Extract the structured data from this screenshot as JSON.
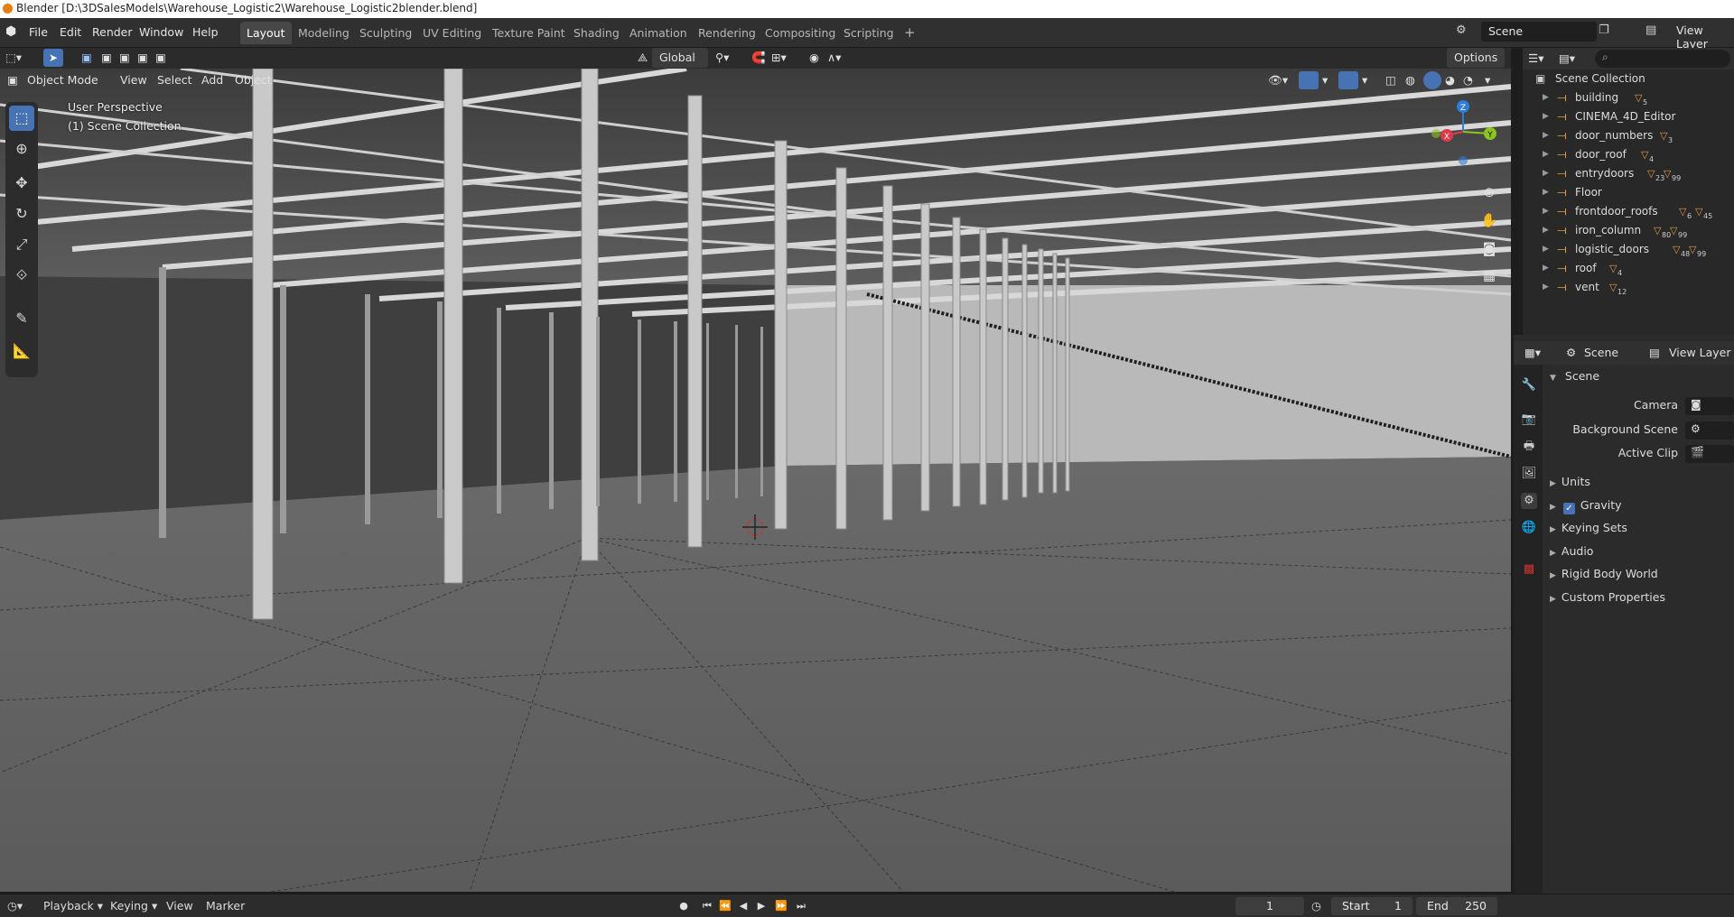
{
  "window_title": "Blender [D:\\3DSalesModels\\Warehouse_Logistic2\\Warehouse_Logistic2blender.blend]",
  "menu": [
    "File",
    "Edit",
    "Render",
    "Window",
    "Help"
  ],
  "workspaces": [
    "Layout",
    "Modeling",
    "Sculpting",
    "UV Editing",
    "Texture Paint",
    "Shading",
    "Animation",
    "Rendering",
    "Compositing",
    "Scripting"
  ],
  "add_workspace": "+",
  "scene_field": "Scene",
  "view_layer_label": "View Layer",
  "viewport_header": {
    "mode": "Object Mode",
    "menus": [
      "View",
      "Select",
      "Add",
      "Object"
    ],
    "orientation": "Global",
    "options": "Options"
  },
  "viewport_overlay": {
    "perspective": "User Perspective",
    "collection": "(1) Scene Collection"
  },
  "gizmo": {
    "z": "Z",
    "y": "Y",
    "x": "X"
  },
  "outliner": {
    "root": "Scene Collection",
    "items": [
      {
        "label": "building",
        "badges": [
          "5"
        ]
      },
      {
        "label": "CINEMA_4D_Editor",
        "badges": []
      },
      {
        "label": "door_numbers",
        "badges": [
          "3"
        ]
      },
      {
        "label": "door_roof",
        "badges": [
          "4"
        ]
      },
      {
        "label": "entrydoors",
        "badges": [
          "23",
          "99"
        ]
      },
      {
        "label": "Floor",
        "badges": []
      },
      {
        "label": "frontdoor_roofs",
        "badges": [
          "6",
          "45"
        ]
      },
      {
        "label": "iron_column",
        "badges": [
          "80",
          "99"
        ]
      },
      {
        "label": "logistic_doors",
        "badges": [
          "48",
          "99"
        ]
      },
      {
        "label": "roof",
        "badges": [
          "4"
        ]
      },
      {
        "label": "vent",
        "badges": [
          "12"
        ]
      }
    ]
  },
  "properties": {
    "header_scene": "Scene",
    "header_view_layer": "View Layer",
    "panel_title": "Scene",
    "camera_label": "Camera",
    "background_scene_label": "Background Scene",
    "active_clip_label": "Active Clip",
    "sections": [
      "Units",
      "Gravity",
      "Keying Sets",
      "Audio",
      "Rigid Body World",
      "Custom Properties"
    ],
    "gravity_checked": true
  },
  "timeline": {
    "menus": [
      "Playback",
      "Keying",
      "View",
      "Marker"
    ],
    "current_frame": "1",
    "start_label": "Start",
    "start_value": "1",
    "end_label": "End",
    "end_value": "250"
  },
  "colors": {
    "accent": "#4772b3",
    "collection_orange": "#e39a48",
    "axis_x": "#e0394a",
    "axis_y": "#8cc51e",
    "axis_z": "#2e7ed9"
  }
}
